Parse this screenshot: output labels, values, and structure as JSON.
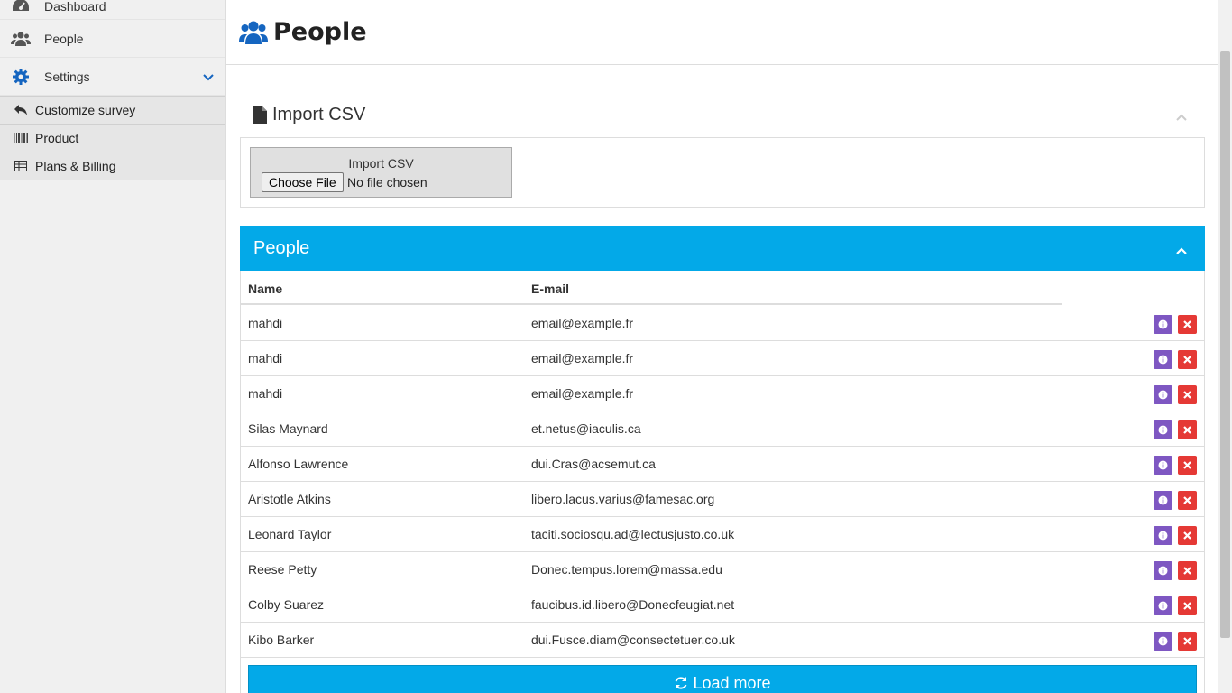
{
  "sidebar": {
    "items": [
      {
        "label": "Dashboard",
        "icon": "dashboard-icon"
      },
      {
        "label": "People",
        "icon": "users-icon"
      },
      {
        "label": "Settings",
        "icon": "gear-icon"
      }
    ],
    "sub_items": [
      {
        "label": "Customize survey",
        "icon": "reply-icon"
      },
      {
        "label": "Product",
        "icon": "barcode-icon"
      },
      {
        "label": "Plans & Billing",
        "icon": "table-icon"
      }
    ]
  },
  "header": {
    "title": "People"
  },
  "import_panel": {
    "title": "Import CSV",
    "field_label": "Import CSV",
    "button_label": "Choose File",
    "status": "No file chosen"
  },
  "people_panel": {
    "title": "People",
    "columns": [
      "Name",
      "E-mail"
    ],
    "rows": [
      {
        "name": "mahdi",
        "email": "email@example.fr"
      },
      {
        "name": "mahdi",
        "email": "email@example.fr"
      },
      {
        "name": "mahdi",
        "email": "email@example.fr"
      },
      {
        "name": "Silas Maynard",
        "email": "et.netus@iaculis.ca"
      },
      {
        "name": "Alfonso Lawrence",
        "email": "dui.Cras@acsemut.ca"
      },
      {
        "name": "Aristotle Atkins",
        "email": "libero.lacus.varius@famesac.org"
      },
      {
        "name": "Leonard Taylor",
        "email": "taciti.sociosqu.ad@lectusjusto.co.uk"
      },
      {
        "name": "Reese Petty",
        "email": "Donec.tempus.lorem@massa.edu"
      },
      {
        "name": "Colby Suarez",
        "email": "faucibus.id.libero@Donecfeugiat.net"
      },
      {
        "name": "Kibo Barker",
        "email": "dui.Fusce.diam@consectetuer.co.uk"
      }
    ],
    "load_more_label": "Load more"
  },
  "colors": {
    "accent": "#03a9e8",
    "info_button": "#7e57c2",
    "delete_button": "#e53935",
    "settings_icon": "#1565c0"
  }
}
